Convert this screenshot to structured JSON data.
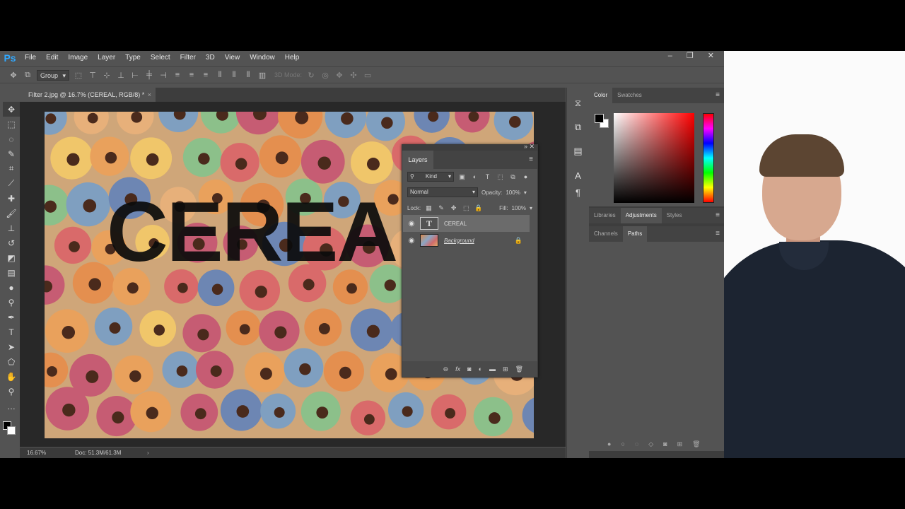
{
  "app": {
    "logo": "Ps",
    "menu": [
      "File",
      "Edit",
      "Image",
      "Layer",
      "Type",
      "Select",
      "Filter",
      "3D",
      "View",
      "Window",
      "Help"
    ],
    "window_controls": [
      "–",
      "❐",
      "✕"
    ]
  },
  "options_bar": {
    "auto_select_value": "Group",
    "mode_3d_label": "3D Mode:"
  },
  "document": {
    "tab_title": "Filter 2.jpg @ 16.7% (CEREAL, RGB/8) *",
    "close_glyph": "×",
    "canvas_text": "CEREAL"
  },
  "status_bar": {
    "zoom": "16.67%",
    "doc_info": "Doc: 51.3M/61.3M",
    "arrow": "›"
  },
  "layers_panel": {
    "title": "Layers",
    "filter_kind": "Kind",
    "blend_mode": "Normal",
    "opacity_label": "Opacity:",
    "opacity_value": "100%",
    "lock_label": "Lock:",
    "fill_label": "Fill:",
    "fill_value": "100%",
    "layers": [
      {
        "name": "CEREAL",
        "type": "text",
        "selected": true
      },
      {
        "name": "Background",
        "type": "image",
        "locked": true
      }
    ],
    "footer_icons": [
      "link-icon",
      "fx-icon",
      "mask-icon",
      "adjustment-icon",
      "folder-icon",
      "new-layer-icon",
      "trash-icon"
    ],
    "fx_label": "fx"
  },
  "color_panel": {
    "tabs": [
      "Color",
      "Swatches"
    ],
    "foreground": "#000000",
    "background": "#ffffff",
    "hue": "#ff0000"
  },
  "adjustments_bar": {
    "tabs": [
      "Libraries",
      "Adjustments",
      "Styles"
    ]
  },
  "paths_bar": {
    "tabs": [
      "Channels",
      "Paths"
    ]
  },
  "colors": {
    "ui_bg": "#535353",
    "canvas_bg": "#282828",
    "accent": "#31a8ff"
  }
}
